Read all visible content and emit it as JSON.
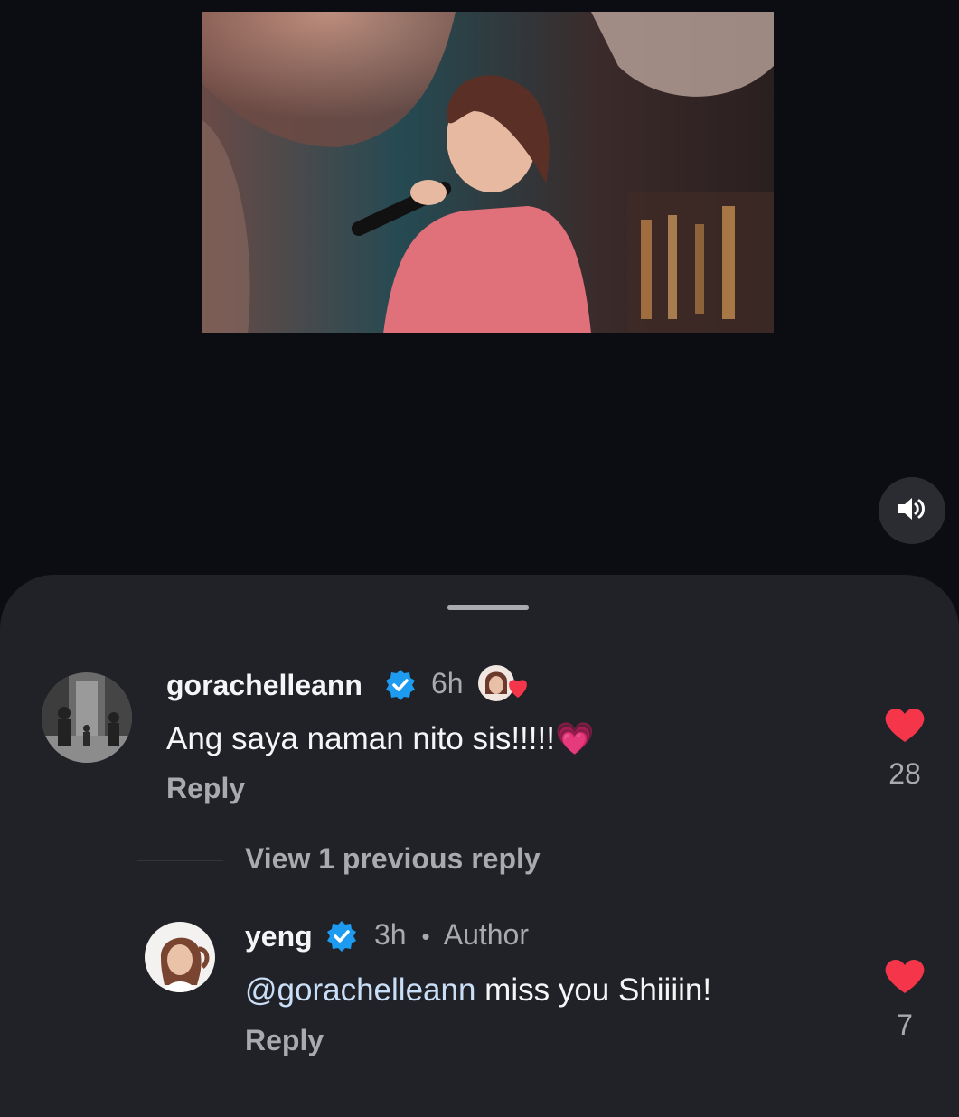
{
  "comments": [
    {
      "username": "gorachelleann",
      "time": "6h",
      "text": "Ang saya naman nito sis!!!!!",
      "emoji": "💗",
      "reply_label": "Reply",
      "likes": "28"
    }
  ],
  "view_replies_label": "View 1 previous reply",
  "reply": {
    "username": "yeng",
    "time": "3h",
    "separator": "•",
    "author_badge": "Author",
    "mention": "@gorachelleann",
    "text": " miss you Shiiiin!",
    "reply_label": "Reply",
    "likes": "7"
  },
  "colors": {
    "sheet_bg": "#212227",
    "verified": "#1d9bf0",
    "heart": "#f5364a"
  },
  "icons": [
    "speaker-icon",
    "verified-icon",
    "heart-icon",
    "liked-by-author-icon"
  ]
}
